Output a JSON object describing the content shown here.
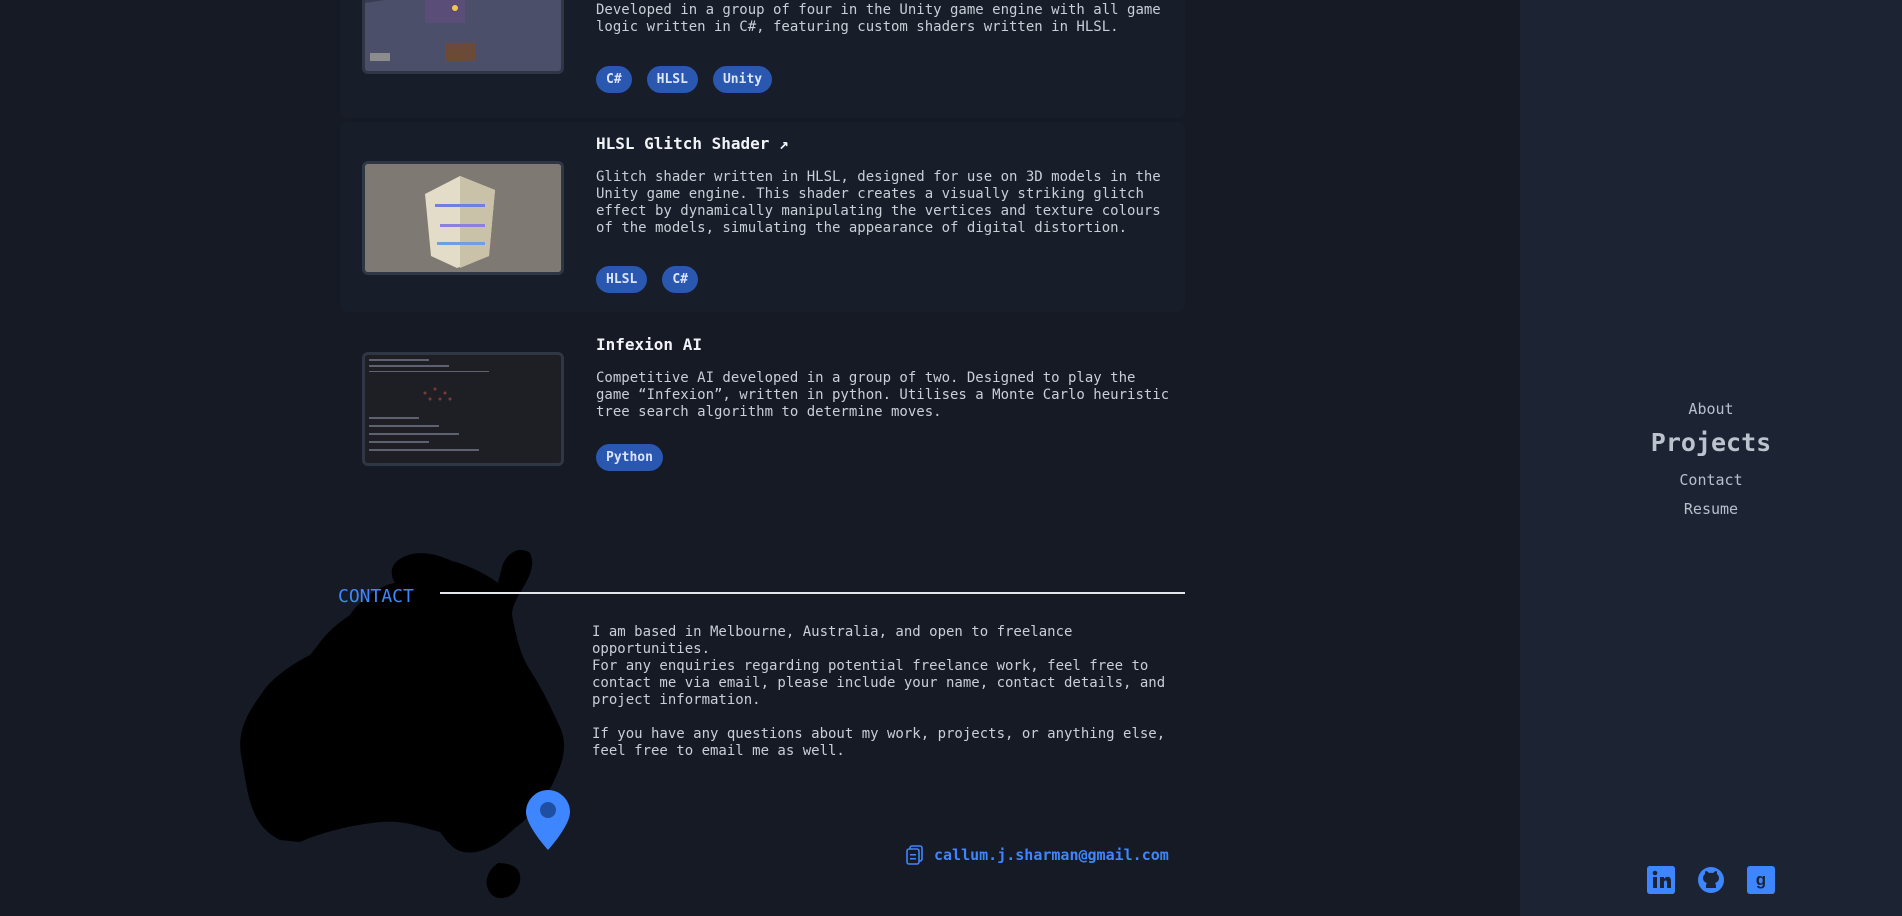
{
  "projects": [
    {
      "title": "",
      "description": "Developed in a group of four in the Unity game engine with all game logic written in C#, featuring custom shaders written in HLSL.",
      "tags": [
        "C#",
        "HLSL",
        "Unity"
      ]
    },
    {
      "title": "HLSL Glitch Shader ↗",
      "description": "Glitch shader written in HLSL, designed for use on 3D models in the Unity game engine. This shader creates a visually striking glitch effect by dynamically manipulating the vertices and texture colours of the models, simulating the appearance of digital distortion.",
      "tags": [
        "HLSL",
        "C#"
      ]
    },
    {
      "title": "Infexion AI",
      "description": "Competitive AI developed in a group of two. Designed to play the game “Infexion”, written in python. Utilises a Monte Carlo heuristic tree search algorithm to determine moves.",
      "tags": [
        "Python"
      ]
    }
  ],
  "contact": {
    "heading": "CONTACT",
    "paragraphs": [
      "I am based in Melbourne, Australia, and open to freelance opportunities.",
      "For any enquiries regarding potential freelance work, feel free to contact me via email, please include your name, contact details, and project information.",
      "If you have any questions about my work, projects, or anything else, feel free to email me as well."
    ],
    "email": "callum.j.sharman@gmail.com",
    "email_icon": "copy-icon",
    "map_icon": "location-pin-icon"
  },
  "nav": {
    "items": [
      "About",
      "Projects",
      "Contact",
      "Resume"
    ],
    "active": "Projects"
  },
  "socials": [
    {
      "name": "linkedin",
      "icon": "linkedin-icon"
    },
    {
      "name": "github",
      "icon": "github-icon"
    },
    {
      "name": "goodreads",
      "icon": "goodreads-icon"
    }
  ],
  "colors": {
    "background": "#151a25",
    "sidebar": "#1c2434",
    "accent": "#3e86ff",
    "tag": "#2a57b0"
  }
}
